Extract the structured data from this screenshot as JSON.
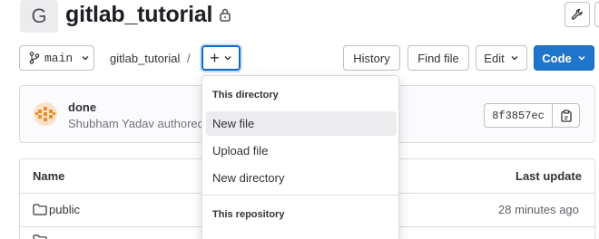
{
  "project": {
    "avatar_letter": "G",
    "name": "gitlab_tutorial"
  },
  "toolbar": {
    "branch": "main",
    "breadcrumb": "gitlab_tutorial",
    "breadcrumb_sep": "/",
    "add_label": "+",
    "history_label": "History",
    "find_file_label": "Find file",
    "edit_label": "Edit",
    "code_label": "Code"
  },
  "commit": {
    "title": "done",
    "author": "Shubham Yadav authored",
    "sha": "8f3857ec"
  },
  "table": {
    "headers": {
      "name": "Name",
      "last_update": "Last update"
    },
    "rows": [
      {
        "name": "public",
        "updated": "28 minutes ago"
      }
    ]
  },
  "dropdown": {
    "section1_header": "This directory",
    "items": [
      "New file",
      "Upload file",
      "New directory"
    ],
    "active_item": "New file",
    "section2_header": "This repository"
  },
  "colors": {
    "primary": "#1f75cb",
    "border": "#dcdcde"
  }
}
